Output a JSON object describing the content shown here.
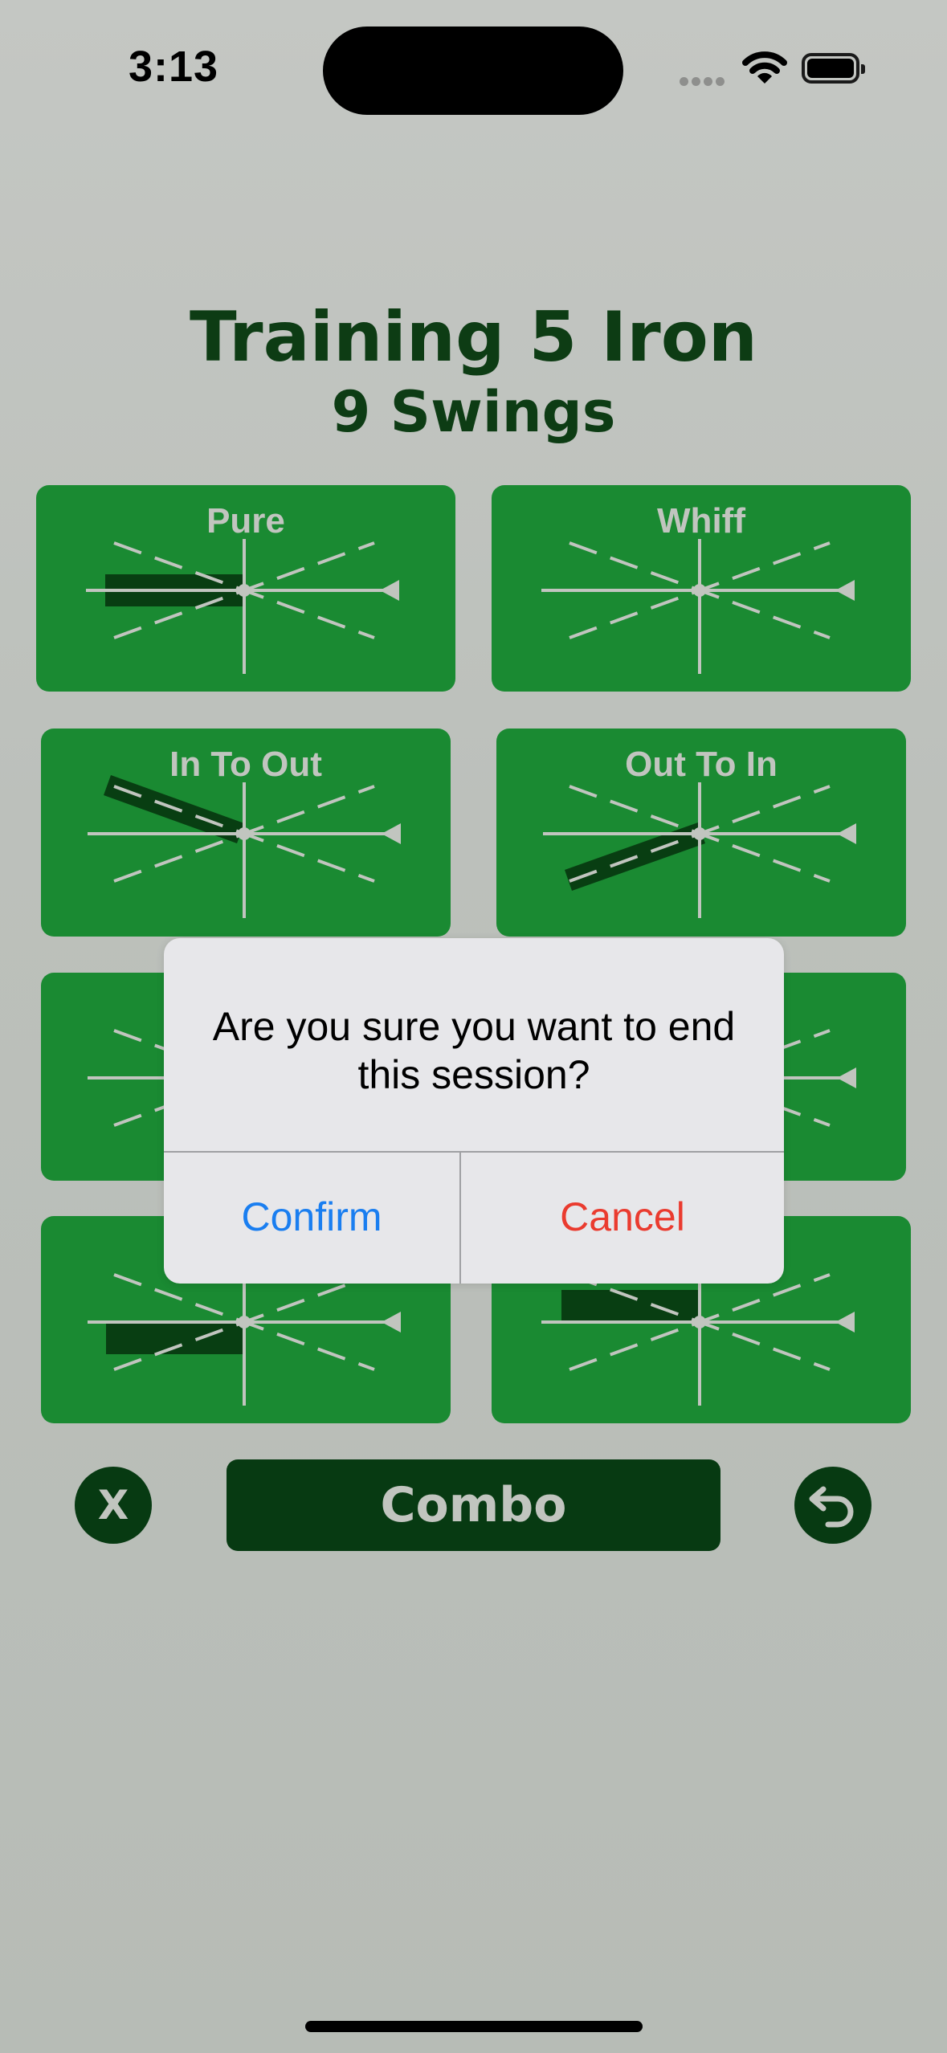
{
  "status_bar": {
    "time": "3:13"
  },
  "header": {
    "title": "Training 5 Iron",
    "subtitle": "9 Swings"
  },
  "tiles": [
    {
      "label": "Pure"
    },
    {
      "label": "Whiff"
    },
    {
      "label": "In To Out"
    },
    {
      "label": "Out To In"
    },
    {
      "label": ""
    },
    {
      "label": ""
    },
    {
      "label": ""
    },
    {
      "label": ""
    }
  ],
  "controls": {
    "cancel_session_label": "X",
    "combo_label": "Combo",
    "undo_icon": "undo-icon"
  },
  "dialog": {
    "message": "Are you sure you want to end this session?",
    "confirm_label": "Confirm",
    "cancel_label": "Cancel"
  },
  "colors": {
    "tile_green": "#1a8a32",
    "dark_green": "#073a12",
    "confirm_blue": "#1a7ef0",
    "cancel_red": "#ea3b2f"
  }
}
